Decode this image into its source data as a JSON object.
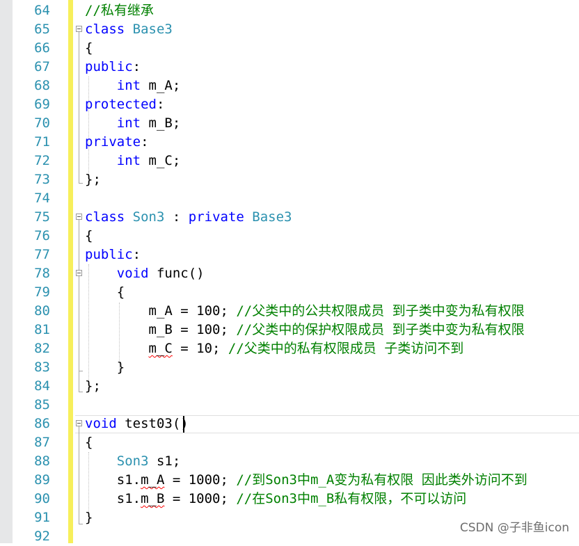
{
  "editor": {
    "line_numbers": [
      "64",
      "65",
      "66",
      "67",
      "68",
      "69",
      "70",
      "71",
      "72",
      "73",
      "74",
      "75",
      "76",
      "77",
      "78",
      "79",
      "80",
      "81",
      "82",
      "83",
      "84",
      "85",
      "86",
      "87",
      "88",
      "89",
      "90",
      "91",
      "92"
    ],
    "lines": [
      {
        "segments": [
          {
            "t": "//私有继承",
            "c": "cm"
          }
        ]
      },
      {
        "segments": [
          {
            "t": "class",
            "c": "kw"
          },
          {
            "t": " ",
            "c": "nm"
          },
          {
            "t": "Base3",
            "c": "ty"
          }
        ]
      },
      {
        "segments": [
          {
            "t": "{",
            "c": "nm"
          }
        ]
      },
      {
        "segments": [
          {
            "t": "public",
            "c": "kw"
          },
          {
            "t": ":",
            "c": "nm"
          }
        ]
      },
      {
        "segments": [
          {
            "t": "    ",
            "c": "nm"
          },
          {
            "t": "int",
            "c": "kw"
          },
          {
            "t": " m_A;",
            "c": "nm"
          }
        ]
      },
      {
        "segments": [
          {
            "t": "protected",
            "c": "kw"
          },
          {
            "t": ":",
            "c": "nm"
          }
        ]
      },
      {
        "segments": [
          {
            "t": "    ",
            "c": "nm"
          },
          {
            "t": "int",
            "c": "kw"
          },
          {
            "t": " m_B;",
            "c": "nm"
          }
        ]
      },
      {
        "segments": [
          {
            "t": "private",
            "c": "kw"
          },
          {
            "t": ":",
            "c": "nm"
          }
        ]
      },
      {
        "segments": [
          {
            "t": "    ",
            "c": "nm"
          },
          {
            "t": "int",
            "c": "kw"
          },
          {
            "t": " m_C;",
            "c": "nm"
          }
        ]
      },
      {
        "segments": [
          {
            "t": "};",
            "c": "nm"
          }
        ]
      },
      {
        "segments": []
      },
      {
        "segments": [
          {
            "t": "class",
            "c": "kw"
          },
          {
            "t": " ",
            "c": "nm"
          },
          {
            "t": "Son3",
            "c": "ty"
          },
          {
            "t": " : ",
            "c": "nm"
          },
          {
            "t": "private",
            "c": "kw"
          },
          {
            "t": " ",
            "c": "nm"
          },
          {
            "t": "Base3",
            "c": "ty"
          }
        ]
      },
      {
        "segments": [
          {
            "t": "{",
            "c": "nm"
          }
        ]
      },
      {
        "segments": [
          {
            "t": "public",
            "c": "kw"
          },
          {
            "t": ":",
            "c": "nm"
          }
        ]
      },
      {
        "segments": [
          {
            "t": "    ",
            "c": "nm"
          },
          {
            "t": "void",
            "c": "kw"
          },
          {
            "t": " func()",
            "c": "nm"
          }
        ]
      },
      {
        "segments": [
          {
            "t": "    {",
            "c": "nm"
          }
        ]
      },
      {
        "segments": [
          {
            "t": "        m_A = 100; ",
            "c": "nm"
          },
          {
            "t": "//父类中的公共权限成员 到子类中变为私有权限",
            "c": "cm"
          }
        ]
      },
      {
        "segments": [
          {
            "t": "        m_B = 100; ",
            "c": "nm"
          },
          {
            "t": "//父类中的保护权限成员 到子类中变为私有权限",
            "c": "cm"
          }
        ]
      },
      {
        "segments": [
          {
            "t": "        ",
            "c": "nm"
          },
          {
            "t": "m_C",
            "c": "nm sq"
          },
          {
            "t": " = 10; ",
            "c": "nm"
          },
          {
            "t": "//父类中的私有权限成员 子类访问不到",
            "c": "cm"
          }
        ]
      },
      {
        "segments": [
          {
            "t": "    }",
            "c": "nm"
          }
        ]
      },
      {
        "segments": [
          {
            "t": "};",
            "c": "nm"
          }
        ]
      },
      {
        "segments": []
      },
      {
        "segments": [
          {
            "t": "void",
            "c": "kw"
          },
          {
            "t": " test03()",
            "c": "nm"
          }
        ]
      },
      {
        "segments": [
          {
            "t": "{",
            "c": "nm"
          }
        ]
      },
      {
        "segments": [
          {
            "t": "    ",
            "c": "nm"
          },
          {
            "t": "Son3",
            "c": "ty"
          },
          {
            "t": " s1;",
            "c": "nm"
          }
        ]
      },
      {
        "segments": [
          {
            "t": "    s1.",
            "c": "nm"
          },
          {
            "t": "m_A",
            "c": "nm sq"
          },
          {
            "t": " = 1000; ",
            "c": "nm"
          },
          {
            "t": "//到Son3中m_A变为私有权限 因此类外访问不到",
            "c": "cm"
          }
        ]
      },
      {
        "segments": [
          {
            "t": "    s1.",
            "c": "nm"
          },
          {
            "t": "m_B",
            "c": "nm sq"
          },
          {
            "t": " = 1000; ",
            "c": "nm"
          },
          {
            "t": "//在Son3中m_B私有权限，不可以访问",
            "c": "cm"
          }
        ]
      },
      {
        "segments": [
          {
            "t": "}",
            "c": "nm"
          }
        ]
      },
      {
        "segments": []
      }
    ]
  },
  "colors": {
    "keyword": "#0000ff",
    "type": "#2b91af",
    "comment": "#008000",
    "line_number": "#2b91af",
    "change_bar": "#f7ef5b",
    "squiggle": "#ff0000"
  },
  "watermark": "CSDN @子非鱼icon"
}
